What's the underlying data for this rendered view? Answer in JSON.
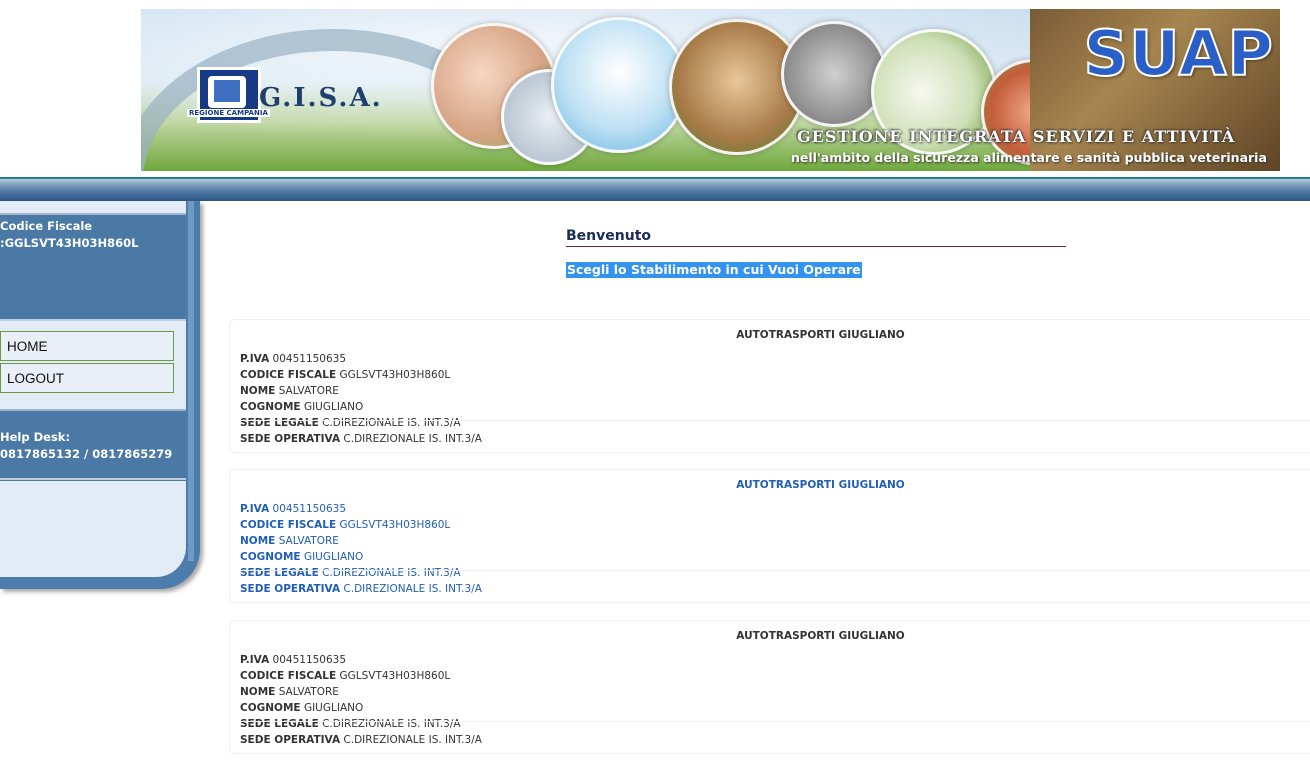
{
  "banner": {
    "logo_text": "G.I.S.A.",
    "logo_subtitle": "REGIONE CAMPANIA",
    "brand": "SUAP",
    "title_line1": "GESTIONE INTEGRATA SERVIZI E ATTIVITÀ",
    "title_line2": "nell'ambito della sicurezza alimentare e sanità pubblica veterinaria"
  },
  "sidebar": {
    "user_label": "Codice Fiscale",
    "user_value": ":GGLSVT43H03H860L",
    "menu": [
      {
        "label": "HOME"
      },
      {
        "label": "LOGOUT"
      }
    ],
    "help_label": "Help Desk:",
    "help_phones": "0817865132 / 0817865279"
  },
  "main": {
    "welcome": "Benvenuto",
    "instruction": "Scegli lo Stabilimento in cui Vuoi Operare",
    "cards": [
      {
        "name": "AUTOTRASPORTI GIUGLIANO",
        "piva_label": "P.IVA",
        "piva": "00451150635",
        "cf_label": "CODICE FISCALE",
        "cf": "GGLSVT43H03H860L",
        "nome_label": "NOME",
        "nome": "SALVATORE",
        "cognome_label": "COGNOME",
        "cognome": "GIUGLIANO",
        "sede_legale_label": "SEDE LEGALE",
        "sede_legale": "C.DIREZIONALE IS. INT.3/A",
        "sede_operativa_label": "SEDE OPERATIVA",
        "sede_operativa": "C.DIREZIONALE IS. INT.3/A"
      },
      {
        "name": "AUTOTRASPORTI GIUGLIANO",
        "piva_label": "P.IVA",
        "piva": "00451150635",
        "cf_label": "CODICE FISCALE",
        "cf": "GGLSVT43H03H860L",
        "nome_label": "NOME",
        "nome": "SALVATORE",
        "cognome_label": "COGNOME",
        "cognome": "GIUGLIANO",
        "sede_legale_label": "SEDE LEGALE",
        "sede_legale": "C.DIREZIONALE IS. INT.3/A",
        "sede_operativa_label": "SEDE OPERATIVA",
        "sede_operativa": "C.DIREZIONALE IS. INT.3/A"
      },
      {
        "name": "AUTOTRASPORTI GIUGLIANO",
        "piva_label": "P.IVA",
        "piva": "00451150635",
        "cf_label": "CODICE FISCALE",
        "cf": "GGLSVT43H03H860L",
        "nome_label": "NOME",
        "nome": "SALVATORE",
        "cognome_label": "COGNOME",
        "cognome": "GIUGLIANO",
        "sede_legale_label": "SEDE LEGALE",
        "sede_legale": "C.DIREZIONALE IS. INT.3/A",
        "sede_operativa_label": "SEDE OPERATIVA",
        "sede_operativa": "C.DIREZIONALE IS. INT.3/A"
      }
    ]
  }
}
